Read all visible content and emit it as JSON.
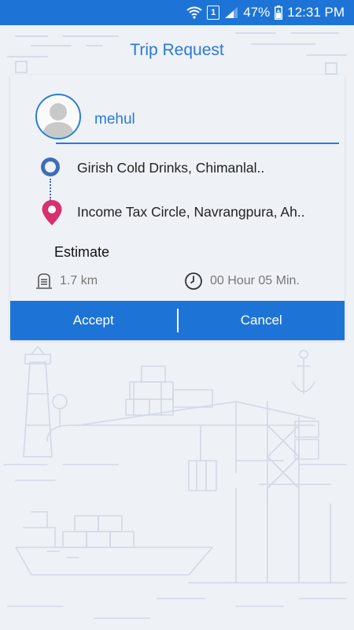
{
  "status_bar": {
    "battery": "47%",
    "time": "12:31 PM",
    "sim_slot": "1",
    "icons": [
      "wifi-icon",
      "sim-icon",
      "signal-icon",
      "battery-icon"
    ]
  },
  "header": {
    "title": "Trip Request"
  },
  "trip": {
    "user_name": "mehul",
    "origin": "Girish Cold Drinks, Chimanlal..",
    "destination": "Income Tax Circle, Navrangpura, Ah..",
    "estimate_title": "Estimate",
    "distance": "1.7 km",
    "duration": "00 Hour 05 Min."
  },
  "actions": {
    "accept_label": "Accept",
    "cancel_label": "Cancel"
  },
  "colors": {
    "primary": "#1e74d6",
    "accent_blue": "#2a7ad8",
    "pin": "#d6316e",
    "origin_ring": "#3f6db8"
  }
}
